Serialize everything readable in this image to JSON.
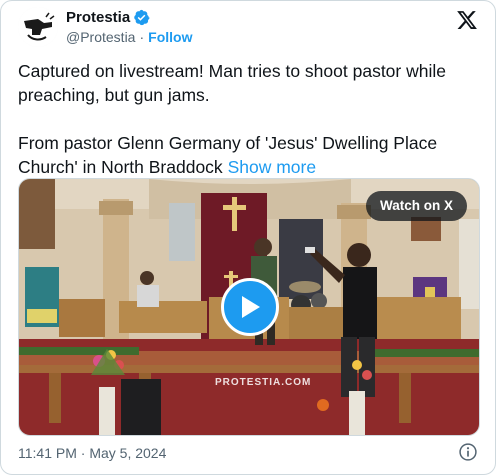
{
  "author": {
    "name": "Protestia",
    "handle": "@Protestia",
    "separator": "·",
    "follow_label": "Follow"
  },
  "tweet": {
    "text": "Captured on livestream! Man tries to shoot pastor while preaching, but gun jams.\n\nFrom pastor Glenn Germany of 'Jesus' Dwelling Place Church' in North Braddock ",
    "show_more": "Show more"
  },
  "media": {
    "watch_label": "Watch on X",
    "watermark": "PROTESTIA.COM"
  },
  "timestamp": "11:41 PM · May 5, 2024",
  "colors": {
    "accent": "#1d9bf0",
    "text": "#0f1419",
    "secondary": "#536471"
  },
  "icons": [
    "verified-badge-icon",
    "x-logo-icon",
    "play-icon",
    "info-icon"
  ]
}
